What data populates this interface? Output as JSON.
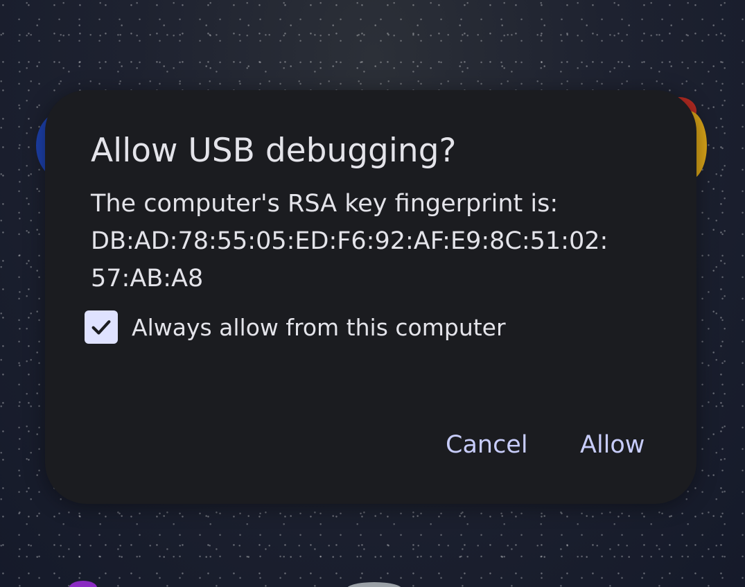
{
  "dialog": {
    "title": "Allow USB debugging?",
    "message_line1": "The computer's RSA key fingerprint is:",
    "fingerprint_line1": "DB:AD:78:55:05:ED:F6:92:AF:E9:8C:51:02:",
    "fingerprint_line2": "57:AB:A8",
    "checkbox": {
      "label": "Always allow from this computer",
      "checked": true,
      "icon": "check-icon"
    },
    "buttons": {
      "cancel_label": "Cancel",
      "allow_label": "Allow"
    }
  },
  "colors": {
    "dialog_background": "#1b1c20",
    "text_primary": "#e4e4ea",
    "accent": "#c8cdfb",
    "checkbox_fill": "#dfe2ff",
    "checkmark": "#1b1c20"
  }
}
